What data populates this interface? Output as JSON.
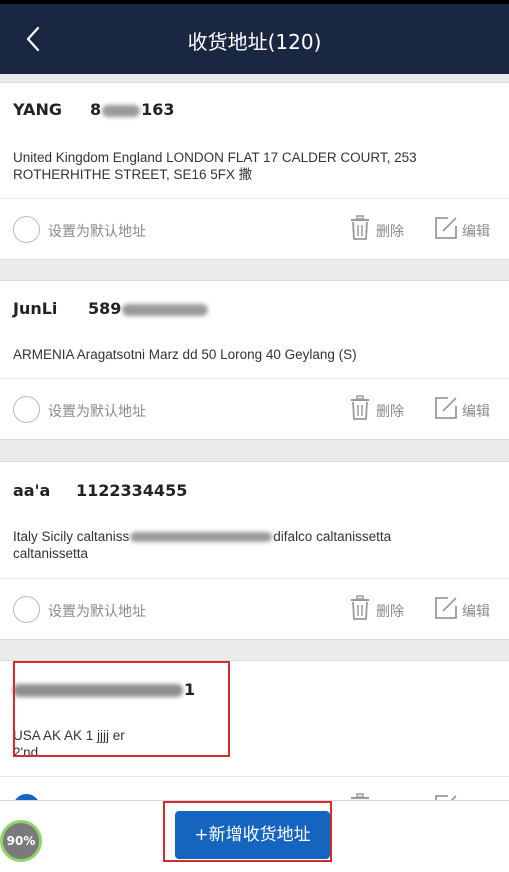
{
  "header": {
    "title": "收货地址(120)",
    "back_icon": "chevron-left-icon"
  },
  "colors": {
    "header_bg": "#1a2743",
    "primary": "#1565c0",
    "annotation_box": "#d42c2c"
  },
  "addresses": [
    {
      "name": "YANG",
      "phone_visible": "8",
      "phone_tail": "163",
      "address": "United Kingdom England  LONDON FLAT 17 CALDER COURT, 253 ROTHERHITHE STREET, SE16 5FX  撒",
      "default_label": "设置为默认地址",
      "delete_label": "删除",
      "edit_label": "编辑",
      "is_default": false
    },
    {
      "name": "JunLi",
      "phone_visible": "589",
      "address": "ARMENIA Aragatsotni Marz dd  50 Lorong 40 Geylang (S)",
      "default_label": "设置为默认地址",
      "delete_label": "删除",
      "edit_label": "编辑",
      "is_default": false
    },
    {
      "name": "aa'a",
      "phone": "1122334455",
      "address_start": "Italy  Sicily caltaniss",
      "address_end": "difalco caltanissetta",
      "address_line2": "caltanissetta",
      "default_label": "设置为默认地址",
      "delete_label": "删除",
      "edit_label": "编辑",
      "is_default": false
    },
    {
      "phone_tail": "1",
      "address": "USA AK AK 1 jjjj er",
      "address_line2": "2'nd",
      "is_default": true
    }
  ],
  "bottom": {
    "add_label": "+新增收货地址",
    "badge": "90%"
  }
}
